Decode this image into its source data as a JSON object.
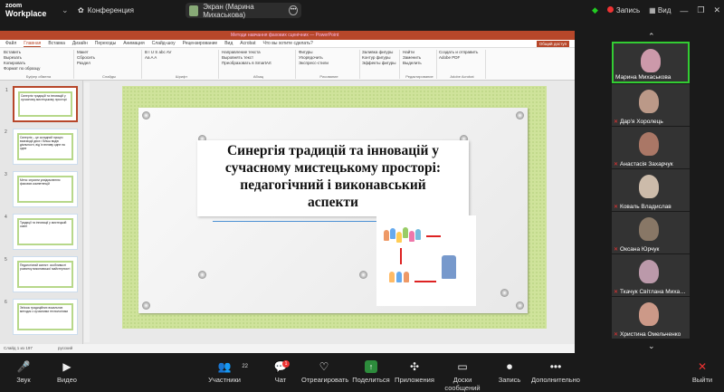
{
  "app": {
    "logo_line1": "zoom",
    "logo_line2": "Workplace"
  },
  "meeting": {
    "title": "Конференция"
  },
  "share_pill": {
    "label": "Экран (Марина Михаськова)"
  },
  "top_right": {
    "record_label": "Запись",
    "view_label": "Вид"
  },
  "ppt": {
    "window_title": "Методи навчання фахових сценічних — PowerPoint",
    "tabs": [
      "Файл",
      "Главная",
      "Вставка",
      "Дизайн",
      "Переходы",
      "Анимация",
      "Слайд-шоу",
      "Рецензирование",
      "Вид",
      "Acrobat",
      "Что вы хотите сделать?"
    ],
    "share_button": "Общий доступ",
    "ribbon_groups": [
      {
        "caption": "Буфер обмена",
        "lines": [
          "Вставить",
          "Вырезать",
          "Копировать",
          "Формат по образцу"
        ]
      },
      {
        "caption": "Слайды",
        "lines": [
          "Макет",
          "Сбросить",
          "Раздел"
        ]
      },
      {
        "caption": "Шрифт",
        "lines": [
          "B I U S abc AV",
          "Aa A A"
        ]
      },
      {
        "caption": "Абзац",
        "lines": [
          "Направление текста",
          "Выровнять текст",
          "Преобразовать в SmartArt"
        ]
      },
      {
        "caption": "Рисование",
        "lines": [
          "Фигуры",
          "Упорядочить",
          "Экспресс-стили"
        ]
      },
      {
        "caption": "",
        "lines": [
          "Заливка фигуры",
          "Контур фигуры",
          "Эффекты фигуры"
        ]
      },
      {
        "caption": "Редактирование",
        "lines": [
          "Найти",
          "Заменить",
          "Выделить"
        ]
      },
      {
        "caption": "Adobe Acrobat",
        "lines": [
          "Создать и отправить",
          "Adobe PDF"
        ]
      }
    ],
    "status_left": "Слайд 1 из 197",
    "status_lang": "русский"
  },
  "thumbnails": [
    {
      "num": "1",
      "text": "Синергія традицій та інновацій у сучасному мистецькому просторі"
    },
    {
      "num": "2",
      "text": "Синергія – це складний процес взаємодії двох і більш видів діяльності, від їх впливу одне на одне"
    },
    {
      "num": "3",
      "text": "Мета: сприяти усвідомленню фахових компетенцій"
    },
    {
      "num": "4",
      "text": "Традиції та інновації у мистецькій освіті"
    },
    {
      "num": "5",
      "text": "Педагогічний аспект: особливості розвитку виконавської майстерності"
    },
    {
      "num": "6",
      "text": "Зв'язок традиційних вокальних методик з сучасними технологіями"
    }
  ],
  "slide": {
    "title_lines": [
      "Синергія традицій та інновацій у",
      "сучасному мистецькому просторі:",
      "педагогічний і виконавський",
      "аспекти"
    ]
  },
  "participants": [
    {
      "name": "Марина Михаськова",
      "muted": false,
      "active": true,
      "color": "#c9a"
    },
    {
      "name": "Дар'я Хоролець",
      "muted": true,
      "active": false,
      "color": "#b98"
    },
    {
      "name": "Анастасія Захарчук",
      "muted": true,
      "active": false,
      "color": "#a76"
    },
    {
      "name": "Коваль Владислав",
      "muted": true,
      "active": false,
      "color": "#cba"
    },
    {
      "name": "Оксана Юрчук",
      "muted": true,
      "active": false,
      "color": "#876"
    },
    {
      "name": "Ткачук Світлана Миха…",
      "muted": true,
      "active": false,
      "color": "#b9a"
    },
    {
      "name": "Христина Омельченко",
      "muted": true,
      "active": false,
      "color": "#c98"
    }
  ],
  "controls": [
    {
      "label": "Звук",
      "icon": "🎤"
    },
    {
      "label": "Видео",
      "icon": "▶"
    },
    {
      "label": "Участники",
      "icon": "👥",
      "count": "22"
    },
    {
      "label": "Чат",
      "icon": "💬",
      "badge": "1"
    },
    {
      "label": "Отреагировать",
      "icon": "♡"
    },
    {
      "label": "Поделиться",
      "icon": "↑"
    },
    {
      "label": "Приложения",
      "icon": "✣"
    },
    {
      "label": "Доски сообщений",
      "icon": "▭"
    },
    {
      "label": "Запись",
      "icon": "⏺"
    },
    {
      "label": "Дополнительно",
      "icon": "•••"
    },
    {
      "label": "Выйти",
      "icon": "✕"
    }
  ]
}
